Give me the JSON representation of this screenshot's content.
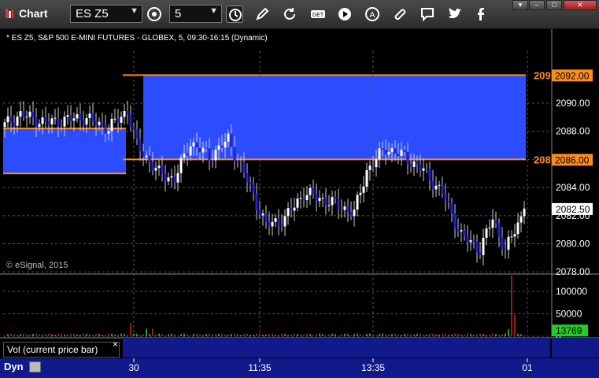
{
  "toolbar": {
    "title": "Chart",
    "symbol": "ES Z5",
    "interval": "5"
  },
  "chart": {
    "title": "* ES Z5, S&P 500 E-MINI FUTURES - GLOBEX, 5, 09:30-16:15 (Dynamic)",
    "copyright": "© eSignal, 2015",
    "price_axis": {
      "ticks": [
        "2090.00",
        "2088.00",
        "2086.00",
        "2084.00",
        "2082.00",
        "2080.00",
        "2078.00"
      ],
      "ylim": [
        2077.9,
        2093.7
      ],
      "current_price_label": "2082.50",
      "current_price": 2082.5
    },
    "zones": [
      {
        "low": 2085.0,
        "high": 2088.2,
        "edge_label": "",
        "color": "#2b4cff"
      },
      {
        "low": 2086.0,
        "high": 2092.0,
        "edge_label": "209",
        "color": "#2b4cff"
      }
    ],
    "tags": [
      {
        "price": 2092.0,
        "label": "2092.00",
        "edge_label": "209"
      },
      {
        "price": 2086.0,
        "label": "2086.00",
        "edge_label": "208"
      }
    ],
    "x_axis": {
      "ticks": [
        {
          "label": "30",
          "bar": 41
        },
        {
          "label": "11:35",
          "bar": 81
        },
        {
          "label": "13:35",
          "bar": 117
        },
        {
          "label": "01",
          "bar": 166
        }
      ]
    },
    "volume": {
      "label": "Vol (current price bar)",
      "close_glyph": "×",
      "ticks": [
        "100000",
        "50000",
        "0"
      ],
      "current_label": "13769",
      "max": 135000
    },
    "footer": {
      "dyn_label": "Dyn"
    },
    "colors": {
      "up_candle": "#ffffff",
      "down_candle": "#2222dd",
      "zone_fill": "#2b4cff",
      "zone_line": "#ff8c1a",
      "price_tag": "#ff8c1a",
      "volume_up": "#33cc33",
      "volume_down": "#cc2222",
      "volume_tag": "#22cc22",
      "bottom_bar": "#101a8a"
    }
  }
}
